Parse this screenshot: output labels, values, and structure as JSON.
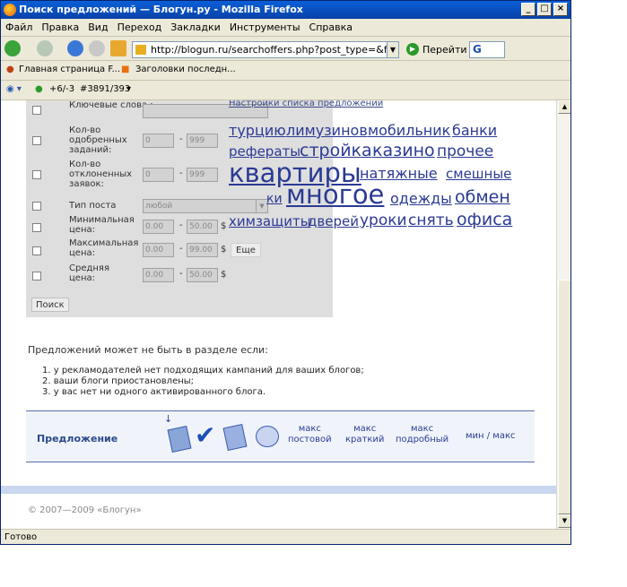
{
  "window": {
    "title": "Поиск предложений — Блогун.ру - Mozilla Firefox",
    "status": "Готово"
  },
  "menu": [
    "Файл",
    "Правка",
    "Вид",
    "Переход",
    "Закладки",
    "Инструменты",
    "Справка"
  ],
  "navigation": {
    "url": "http://blogun.ru/searchoffers.php?post_type=&filt=actual&rea",
    "go_label": "Перейти",
    "google_box": "G"
  },
  "bookmarks": [
    "Главная страница F...",
    "Заголовки последн..."
  ],
  "toolbar2": {
    "counter": "+6/-3",
    "id": "#3891/393"
  },
  "filter": {
    "rows": [
      {
        "label": "Ключевые слова :",
        "min": "",
        "max": ""
      },
      {
        "label": "Кол-во одобренных заданий:",
        "min": "0",
        "max": "999"
      },
      {
        "label": "Кол-во отклоненных заявок:",
        "min": "0",
        "max": "999"
      },
      {
        "label": "Тип поста",
        "select": "любой"
      },
      {
        "label": "Минимальная цена:",
        "min": "0.00",
        "max": "50.00",
        "unit": "$"
      },
      {
        "label": "Максимальная цена:",
        "min": "0.00",
        "max": "99.00",
        "unit": "$"
      },
      {
        "label": "Средняя цена:",
        "min": "0.00",
        "max": "50.00",
        "unit": "$"
      }
    ],
    "more_label": "Еще",
    "search_label": "Поиск"
  },
  "cloud": {
    "settings_link": "Настройки списка предложений",
    "tags": [
      {
        "text": "турцию"
      },
      {
        "text": "лимузинов"
      },
      {
        "text": "мобильник"
      },
      {
        "text": "банки"
      },
      {
        "text": "рефераты"
      },
      {
        "text": "стройка"
      },
      {
        "text": "казино"
      },
      {
        "text": "прочее"
      },
      {
        "text": "квартиры"
      },
      {
        "text": "натяжные"
      },
      {
        "text": "смешные"
      },
      {
        "text": "ки"
      },
      {
        "text": "многое"
      },
      {
        "text": "одежды"
      },
      {
        "text": "обмен"
      },
      {
        "text": "химзащиты"
      },
      {
        "text": "дверей"
      },
      {
        "text": "уроки"
      },
      {
        "text": "снять"
      },
      {
        "text": "офиса"
      }
    ]
  },
  "info": {
    "intro": "Предложений может не быть в разделе если:",
    "items": [
      "1.  у рекламодателей нет подходящих кампаний для ваших блогов;",
      "2.  ваши блоги приостановлены;",
      "3.  у вас нет ни одного активированного блога."
    ]
  },
  "offers": {
    "label": "Предложение",
    "sort_arrow": "↓",
    "sorts": [
      {
        "line1": "макс",
        "line2": "постовой"
      },
      {
        "line1": "макс",
        "line2": "краткий"
      },
      {
        "line1": "макс",
        "line2": "подробный"
      }
    ],
    "minmax": "мин / макс"
  },
  "footer": {
    "copyright": "© 2007—2009 «Блогун»"
  }
}
